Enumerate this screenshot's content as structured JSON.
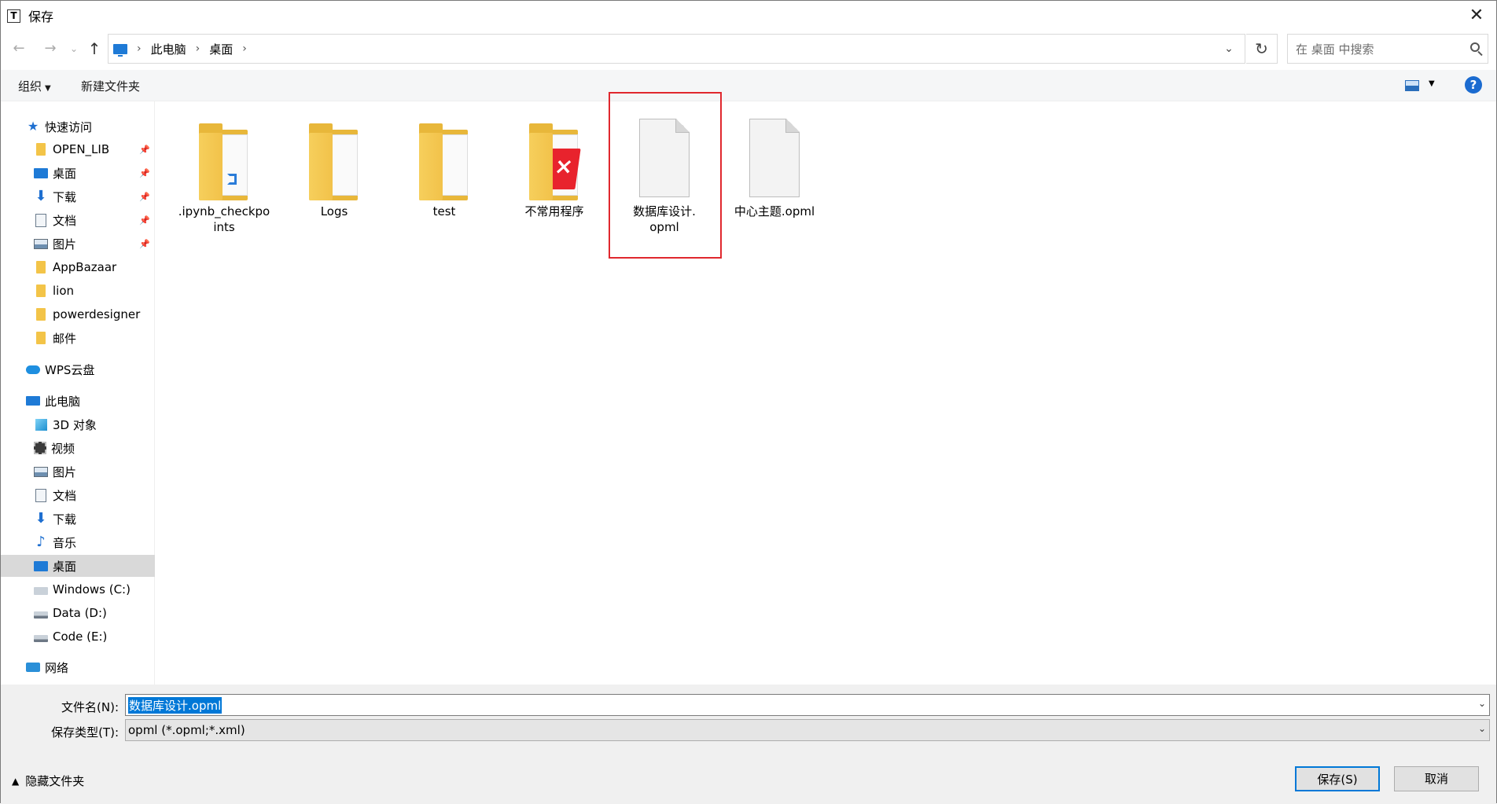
{
  "window": {
    "title": "保存",
    "app_icon_letter": "T"
  },
  "nav": {
    "breadcrumbs": [
      "此电脑",
      "桌面"
    ],
    "search_placeholder": "在 桌面 中搜索"
  },
  "toolbar": {
    "organize": "组织",
    "new_folder": "新建文件夹"
  },
  "sidebar": {
    "quick_access": "快速访问",
    "quick_items": [
      {
        "label": "OPEN_LIB",
        "pinned": true
      },
      {
        "label": "桌面",
        "pinned": true
      },
      {
        "label": "下载",
        "pinned": true
      },
      {
        "label": "文档",
        "pinned": true
      },
      {
        "label": "图片",
        "pinned": true
      },
      {
        "label": "AppBazaar"
      },
      {
        "label": "lion"
      },
      {
        "label": "powerdesigner"
      },
      {
        "label": "邮件"
      }
    ],
    "wps_cloud": "WPS云盘",
    "this_pc": "此电脑",
    "pc_items": [
      "3D 对象",
      "视频",
      "图片",
      "文档",
      "下载",
      "音乐",
      "桌面",
      "Windows (C:)",
      "Data (D:)",
      "Code (E:)"
    ],
    "selected": "桌面",
    "network": "网络"
  },
  "files": [
    {
      "name": ".ipynb_checkpoints",
      "type": "folder",
      "line1": ".ipynb_checkpo",
      "line2": "ints"
    },
    {
      "name": "Logs",
      "type": "folder",
      "line1": "Logs",
      "line2": ""
    },
    {
      "name": "test",
      "type": "folder",
      "line1": "test",
      "line2": ""
    },
    {
      "name": "不常用程序",
      "type": "folder",
      "line1": "不常用程序",
      "line2": ""
    },
    {
      "name": "数据库设计.opml",
      "type": "file",
      "line1": "数据库设计.",
      "line2": "opml",
      "highlighted": true
    },
    {
      "name": "中心主题.opml",
      "type": "file",
      "line1": "中心主题.opml",
      "line2": ""
    }
  ],
  "form": {
    "filename_label": "文件名(N):",
    "filename_value": "数据库设计.opml",
    "filetype_label": "保存类型(T):",
    "filetype_value": "opml (*.opml;*.xml)"
  },
  "footer": {
    "hide_folders": "隐藏文件夹",
    "save": "保存(S)",
    "cancel": "取消"
  },
  "colors": {
    "accent": "#0078d7",
    "highlight": "#e0282e",
    "folder": "#f3c448"
  }
}
